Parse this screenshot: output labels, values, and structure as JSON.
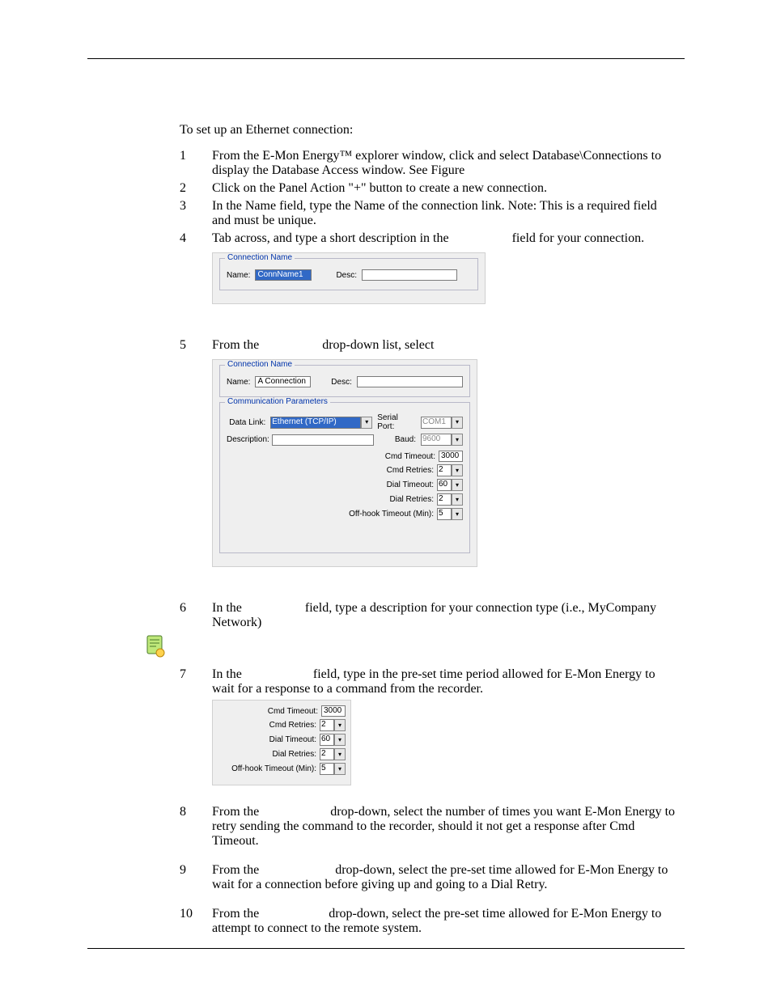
{
  "intro": "To set up an Ethernet connection:",
  "steps": {
    "1": {
      "n": "1",
      "t": "From the E-Mon Energy™ explorer window, click and select Database\\Connections to display the Database Access window. See Figure"
    },
    "2": {
      "n": "2",
      "t": "Click on the Panel Action \"+\" button to create a new connection."
    },
    "3": {
      "n": "3",
      "t": "In the Name field, type the Name of the connection link. Note: This is a required field and must be unique."
    },
    "4": {
      "n": "4",
      "t1": "Tab across, and type a short description in the",
      "t2": "field for your connection."
    },
    "5": {
      "n": "5",
      "t1": "From the",
      "t2": "drop-down list, select"
    },
    "6": {
      "n": "6",
      "t1": "In the",
      "t2": "field, type a description for your connection type (i.e., MyCompany Network)"
    },
    "7": {
      "n": "7",
      "t1": "In the",
      "t2": "field, type in the pre-set time period allowed for E-Mon Energy to wait for a response to a command from the recorder."
    },
    "8": {
      "n": "8",
      "t1": "From the",
      "t2": "drop-down, select the number of times you want E-Mon Energy to retry sending the command to the recorder, should it not get a response after Cmd Timeout."
    },
    "9": {
      "n": "9",
      "t1": "From the",
      "t2": "drop-down, select the pre-set time allowed for E-Mon Energy to wait for a connection before giving up and going to a Dial Retry."
    },
    "10": {
      "n": "10",
      "t1": "From the",
      "t2": "drop-down, select the pre-set time allowed for E-Mon Energy to attempt to connect to the remote system."
    }
  },
  "fig1": {
    "legend": "Connection Name",
    "name_lbl": "Name:",
    "name_val": "ConnName1",
    "desc_lbl": "Desc:"
  },
  "fig2": {
    "legend1": "Connection Name",
    "name_lbl": "Name:",
    "name_val": "A Connection",
    "desc_lbl": "Desc:",
    "legend2": "Communication Parameters",
    "datalink_lbl": "Data Link:",
    "datalink_val": "Ethernet (TCP/IP)",
    "description_lbl": "Description:",
    "serial_lbl": "Serial Port:",
    "serial_val": "COM1",
    "baud_lbl": "Baud:",
    "baud_val": "9600",
    "p1_lbl": "Cmd Timeout:",
    "p1_val": "3000",
    "p2_lbl": "Cmd Retries:",
    "p2_val": "2",
    "p3_lbl": "Dial Timeout:",
    "p3_val": "60",
    "p4_lbl": "Dial Retries:",
    "p4_val": "2",
    "p5_lbl": "Off-hook Timeout (Min):",
    "p5_val": "5"
  },
  "fig3": {
    "p1_lbl": "Cmd Timeout:",
    "p1_val": "3000",
    "p2_lbl": "Cmd Retries:",
    "p2_val": "2",
    "p3_lbl": "Dial Timeout:",
    "p3_val": "60",
    "p4_lbl": "Dial Retries:",
    "p4_val": "2",
    "p5_lbl": "Off-hook Timeout (Min):",
    "p5_val": "5"
  }
}
